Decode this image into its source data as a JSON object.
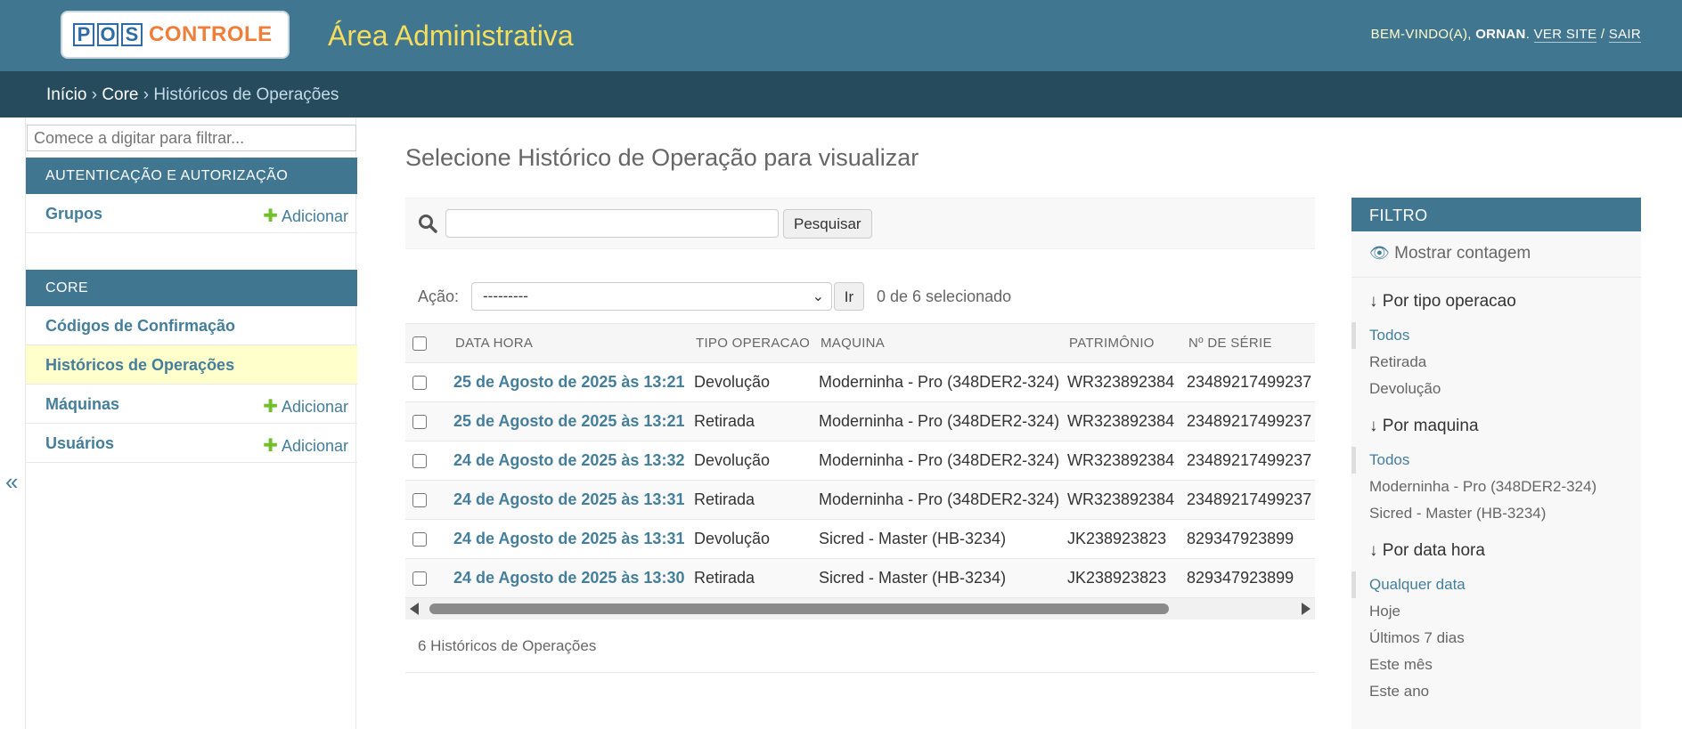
{
  "header": {
    "logo_left": "POS",
    "logo_right": "CONTROLE",
    "site_title": "Área Administrativa",
    "welcome": "BEM-VINDO(A), ",
    "user": "ORNAN",
    "view_site": "VER SITE",
    "separator": " / ",
    "logout": "SAIR"
  },
  "breadcrumbs": {
    "home": "Início",
    "sep": " › ",
    "app": "Core",
    "current": "Históricos de Operações"
  },
  "sidebar": {
    "filter_placeholder": "Comece a digitar para filtrar...",
    "modules": [
      {
        "caption": "AUTENTICAÇÃO E AUTORIZAÇÃO",
        "items": [
          {
            "label": "Grupos",
            "add": "Adicionar"
          }
        ]
      },
      {
        "caption": "CORE",
        "items": [
          {
            "label": "Códigos de Confirmação",
            "add": ""
          },
          {
            "label": "Históricos de Operações",
            "add": ""
          },
          {
            "label": "Máquinas",
            "add": "Adicionar"
          },
          {
            "label": "Usuários",
            "add": "Adicionar"
          }
        ]
      }
    ],
    "toggle": "«"
  },
  "content": {
    "title": "Selecione Histórico de Operação para visualizar",
    "search_button": "Pesquisar",
    "action_label": "Ação:",
    "action_selected": "---------",
    "go_button": "Ir",
    "selection_counter": "0 de 6 selecionado",
    "columns": [
      "DATA HORA",
      "TIPO OPERACAO",
      "MAQUINA",
      "PATRIMÔNIO",
      "Nº DE SÉRIE"
    ],
    "rows": [
      {
        "date": "25 de Agosto de 2025 às 13:21",
        "tipo": "Devolução",
        "maquina": "Moderninha - Pro (348DER2-324)",
        "patrimonio": "WR323892384",
        "serie": "23489217499237"
      },
      {
        "date": "25 de Agosto de 2025 às 13:21",
        "tipo": "Retirada",
        "maquina": "Moderninha - Pro (348DER2-324)",
        "patrimonio": "WR323892384",
        "serie": "23489217499237"
      },
      {
        "date": "24 de Agosto de 2025 às 13:32",
        "tipo": "Devolução",
        "maquina": "Moderninha - Pro (348DER2-324)",
        "patrimonio": "WR323892384",
        "serie": "23489217499237"
      },
      {
        "date": "24 de Agosto de 2025 às 13:31",
        "tipo": "Retirada",
        "maquina": "Moderninha - Pro (348DER2-324)",
        "patrimonio": "WR323892384",
        "serie": "23489217499237"
      },
      {
        "date": "24 de Agosto de 2025 às 13:31",
        "tipo": "Devolução",
        "maquina": "Sicred - Master (HB-3234)",
        "patrimonio": "JK238923823",
        "serie": "829347923899"
      },
      {
        "date": "24 de Agosto de 2025 às 13:30",
        "tipo": "Retirada",
        "maquina": "Sicred - Master (HB-3234)",
        "patrimonio": "JK238923823",
        "serie": "829347923899"
      }
    ],
    "paginator": "6 Históricos de Operações"
  },
  "filter": {
    "title": "FILTRO",
    "show_counts": "Mostrar contagem",
    "groups": [
      {
        "title": "↓ Por tipo operacao",
        "options": [
          "Todos",
          "Retirada",
          "Devolução"
        ]
      },
      {
        "title": "↓ Por maquina",
        "options": [
          "Todos",
          "Moderninha - Pro (348DER2-324)",
          "Sicred - Master (HB-3234)"
        ]
      },
      {
        "title": "↓ Por data hora",
        "options": [
          "Qualquer data",
          "Hoje",
          "Últimos 7 dias",
          "Este mês",
          "Este ano"
        ]
      }
    ]
  },
  "colors": {
    "header_bg": "#417690",
    "breadcrumb_bg": "#264b5d",
    "link": "#447e9b",
    "site_title": "#f5dd5d",
    "current_row": "#ffffcc",
    "add_plus": "#70bf2b"
  }
}
